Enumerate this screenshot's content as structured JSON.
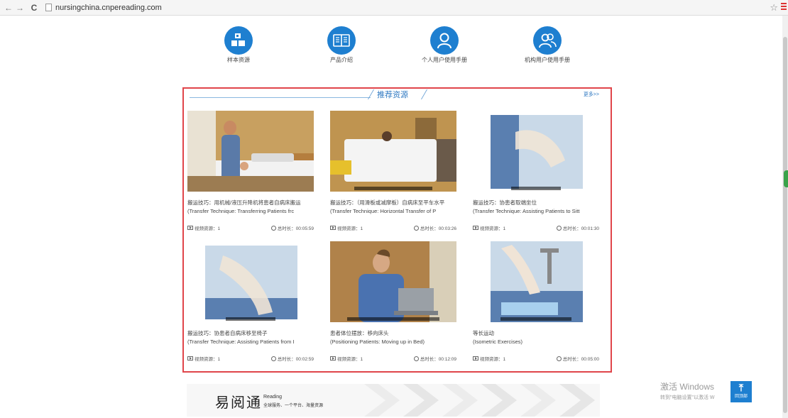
{
  "browser": {
    "url": "nursingchina.cnpereading.com"
  },
  "nav": [
    {
      "label": "样本资源",
      "icon": "sample-resources-icon"
    },
    {
      "label": "产品介绍",
      "icon": "book-icon"
    },
    {
      "label": "个人用户使用手册",
      "icon": "user-icon"
    },
    {
      "label": "机构用户使用手册",
      "icon": "group-users-icon"
    }
  ],
  "recommend": {
    "title": "推荐资源",
    "more": "更多>>",
    "items": [
      {
        "title": "搬运技巧：用机械/液压升降机将患者自病床搬运",
        "en": "(Transfer Technique: Transferring Patients frc",
        "videos": "视频资源：1",
        "duration": "总时长：00:05:59"
      },
      {
        "title": "搬运技巧：（用滑板或减摩板）自病床至平车水平",
        "en": "(Transfer Technique: Horizontal Transfer of P",
        "videos": "视频资源：1",
        "duration": "总时长：00:03:26"
      },
      {
        "title": "搬运技巧：协患者取端坐位",
        "en": "(Transfer Technique: Assisting Patients to Sitt",
        "videos": "视频资源：1",
        "duration": "总时长：00:01:30"
      },
      {
        "title": "搬运技巧：协患者自病床移至椅子",
        "en": "(Transfer Technique: Assisting Patients from I",
        "videos": "视频资源：1",
        "duration": "总时长：00:02:59"
      },
      {
        "title": "患者体位摆放：移向床头",
        "en": "(Positioning Patients: Moving up in Bed)",
        "videos": "视频资源：1",
        "duration": "总时长：00:12:09"
      },
      {
        "title": "等长运动",
        "en": "(Isometric Exercises)",
        "videos": "视频资源：1",
        "duration": "总时长：00:05:00"
      }
    ]
  },
  "banner": {
    "brand": "易阅通",
    "reading": "Reading",
    "tagline": "全球服务、一个平台、海量资源"
  },
  "watermark": {
    "line1": "激活 Windows",
    "line2": "转到\"电脑设置\"以激活 W"
  },
  "back_to_top": "回顶部",
  "colors": {
    "accent": "#1e7fd0",
    "panel_border": "#e0454a"
  }
}
